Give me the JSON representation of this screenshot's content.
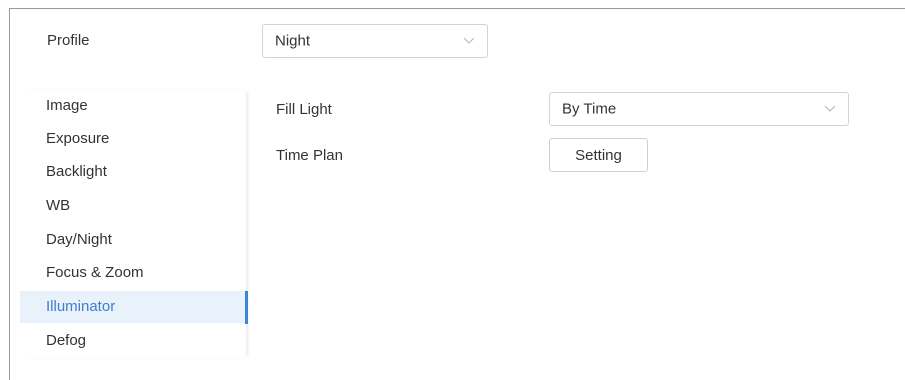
{
  "profile": {
    "label": "Profile",
    "selected": "Night"
  },
  "sidebar": {
    "active_index": 6,
    "items": [
      {
        "label": "Image"
      },
      {
        "label": "Exposure"
      },
      {
        "label": "Backlight"
      },
      {
        "label": "WB"
      },
      {
        "label": "Day/Night"
      },
      {
        "label": "Focus & Zoom"
      },
      {
        "label": "Illuminator"
      },
      {
        "label": "Defog"
      }
    ]
  },
  "illuminator": {
    "fill_light": {
      "label": "Fill Light",
      "selected": "By Time"
    },
    "time_plan": {
      "label": "Time Plan",
      "button_label": "Setting"
    }
  },
  "colors": {
    "accent": "#3a86d6",
    "active_bg": "#e9f1fa",
    "text": "#333333",
    "border": "#d3d3d3"
  },
  "icons": {
    "dropdown": "chevron-down-icon"
  }
}
